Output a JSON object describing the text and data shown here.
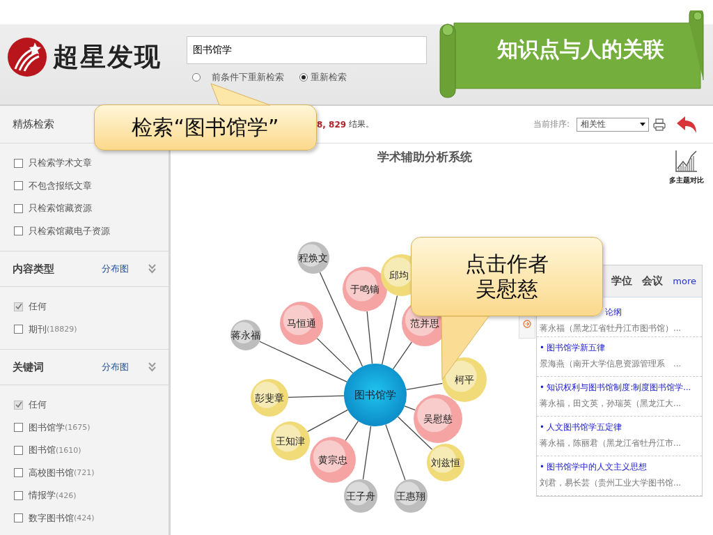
{
  "title_banner": {
    "text": "知识点与人的关联"
  },
  "callouts": [
    {
      "text": "检索“图书馆学”"
    },
    {
      "text": "点击作者吴慰慈"
    }
  ],
  "header": {
    "logo_text": "超星发现",
    "search": {
      "value": "图书馆学"
    },
    "radios": [
      {
        "label": "前条件下重新检索",
        "selected": false
      },
      {
        "label": "重新检索",
        "selected": true
      }
    ]
  },
  "sidebar": {
    "title": "精炼检索",
    "options": [
      {
        "label": "只检索学术文章",
        "checked": false
      },
      {
        "label": "不包含报纸文章",
        "checked": false
      },
      {
        "label": "只检索馆藏资源",
        "checked": false
      },
      {
        "label": "只检索馆藏电子资源",
        "checked": false
      }
    ],
    "sections": [
      {
        "title": "内容类型",
        "link": "分布图",
        "items": [
          {
            "label": "任何",
            "checked": true
          },
          {
            "label": "期刊",
            "count": "(18829)",
            "checked": false
          }
        ]
      },
      {
        "title": "关键词",
        "link": "分布图",
        "items": [
          {
            "label": "任何",
            "checked": true
          },
          {
            "label": "图书馆学",
            "count": "(1675)",
            "checked": false
          },
          {
            "label": "图书馆",
            "count": "(1610)",
            "checked": false
          },
          {
            "label": "高校图书馆",
            "count": "(721)",
            "checked": false
          },
          {
            "label": "情报学",
            "count": "(426)",
            "checked": false
          },
          {
            "label": "数字图书馆",
            "count": "(424)",
            "checked": false
          }
        ]
      }
    ]
  },
  "results_bar": {
    "count": "8, 829",
    "suffix": "结果。",
    "sort_label": "当前排序:",
    "sort_value": "相关性"
  },
  "analysis": {
    "title": "学术辅助分析系统",
    "compare_label": "多主题对比",
    "graph": {
      "center": "图书馆学",
      "nodes": [
        {
          "label": "程焕文",
          "color": "#bdbdbd"
        },
        {
          "label": "于鸣镝",
          "color": "#f5a3a3"
        },
        {
          "label": "邱均",
          "color": "#f0db78"
        },
        {
          "label": "马恒通",
          "color": "#f5a3a3"
        },
        {
          "label": "蒋永福",
          "color": "#bdbdbd"
        },
        {
          "label": "范并思",
          "color": "#f5a3a3"
        },
        {
          "label": "柯平",
          "color": "#f0db78"
        },
        {
          "label": "彭斐章",
          "color": "#f0db78"
        },
        {
          "label": "吴慰慈",
          "color": "#f5a3a3"
        },
        {
          "label": "王知津",
          "color": "#f0db78"
        },
        {
          "label": "黄宗忠",
          "color": "#f5a3a3"
        },
        {
          "label": "刘兹恒",
          "color": "#f0db78"
        },
        {
          "label": "王子舟",
          "color": "#bdbdbd"
        },
        {
          "label": "王惠翔",
          "color": "#bdbdbd"
        }
      ]
    },
    "panel": {
      "tabs": [
        {
          "label": "学位",
          "selected": false
        },
        {
          "label": "会议",
          "selected": false
        }
      ],
      "more": "more",
      "items": [
        {
          "title": "论纲",
          "authors": "蒋永福（黑龙江省牡丹江市图书馆）..."
        },
        {
          "title": "• 图书馆学新五律",
          "authors": "景海燕（南开大学信息资源管理系　..."
        },
        {
          "title": "• 知识权利与图书馆制度:制度图书馆学...",
          "authors": "蒋永福，田文英，孙瑞英（黑龙江大..."
        },
        {
          "title": "• 人文图书馆学五定律",
          "authors": "蒋永福，陈丽君（黑龙江省牡丹江市..."
        },
        {
          "title": "• 图书馆学中的人文主义思想",
          "authors": "刘君，易长芸（贵州工业大学图书馆..."
        }
      ]
    }
  }
}
